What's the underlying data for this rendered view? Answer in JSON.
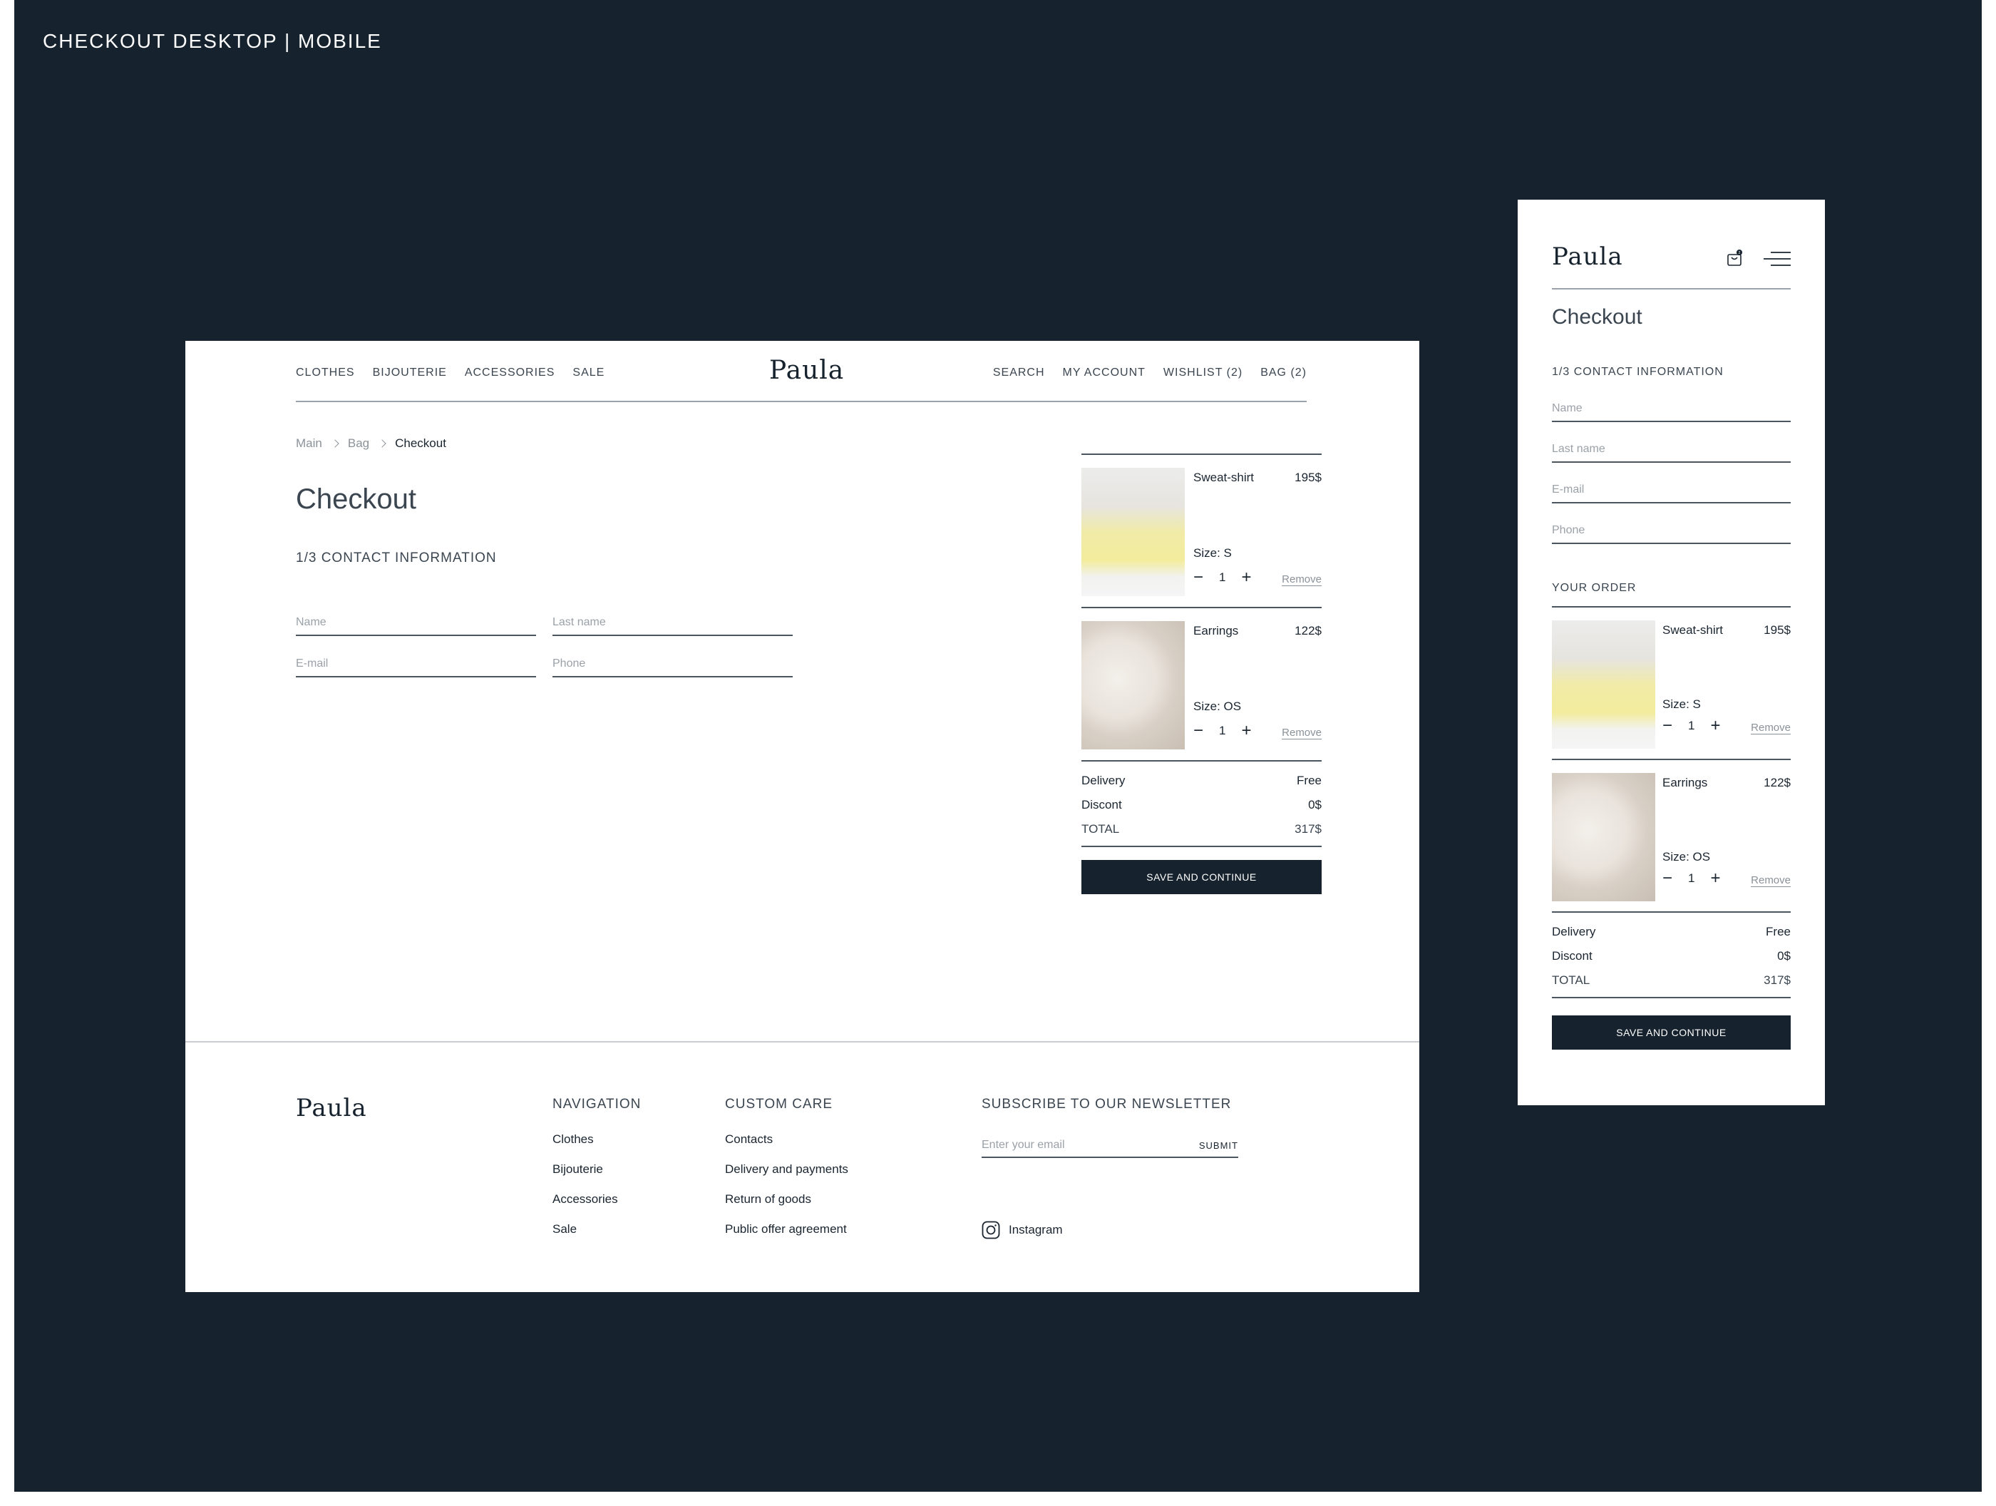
{
  "page_label": "CHECKOUT DESKTOP | MOBILE",
  "brand": "Paula",
  "header": {
    "nav_left": [
      "CLOTHES",
      "BIJOUTERIE",
      "ACCESSORIES",
      "SALE"
    ],
    "nav_right": [
      "SEARCH",
      "MY ACCOUNT",
      "WISHLIST (2)",
      "BAG (2)"
    ]
  },
  "breadcrumb": [
    "Main",
    "Bag",
    "Checkout"
  ],
  "checkout": {
    "title": "Checkout",
    "step": "1/3 CONTACT INFORMATION",
    "fields": {
      "name": "Name",
      "last_name": "Last name",
      "email": "E-mail",
      "phone": "Phone"
    }
  },
  "order": {
    "heading": "YOUR ORDER",
    "items": [
      {
        "name": "Sweat-shirt",
        "price": "195$",
        "size": "Size: S",
        "qty": "1",
        "remove": "Remove",
        "image": "sweatshirt-photo"
      },
      {
        "name": "Earrings",
        "price": "122$",
        "size": "Size: OS",
        "qty": "1",
        "remove": "Remove",
        "image": "earrings-photo"
      }
    ],
    "delivery_label": "Delivery",
    "delivery_value": "Free",
    "discount_label": "Discont",
    "discount_value": "0$",
    "total_label": "TOTAL",
    "total_value": "317$",
    "cta": "SAVE AND CONTINUE",
    "qty_minus": "−",
    "qty_plus": "+"
  },
  "footer": {
    "navigation_head": "NAVIGATION",
    "navigation": [
      "Clothes",
      "Bijouterie",
      "Accessories",
      "Sale"
    ],
    "care_head": "CUSTOM CARE",
    "care": [
      "Contacts",
      "Delivery and payments",
      "Return of goods",
      "Public offer agreement"
    ],
    "newsletter_head": "SUBSCRIBE TO OUR NEWSLETTER",
    "email_placeholder": "Enter your email",
    "submit": "SUBMIT",
    "instagram": "Instagram"
  },
  "mobile": {
    "bag_count": "2"
  },
  "colors": {
    "canvas": "#16222d",
    "accent": "#16222d",
    "muted": "#8a9299"
  }
}
